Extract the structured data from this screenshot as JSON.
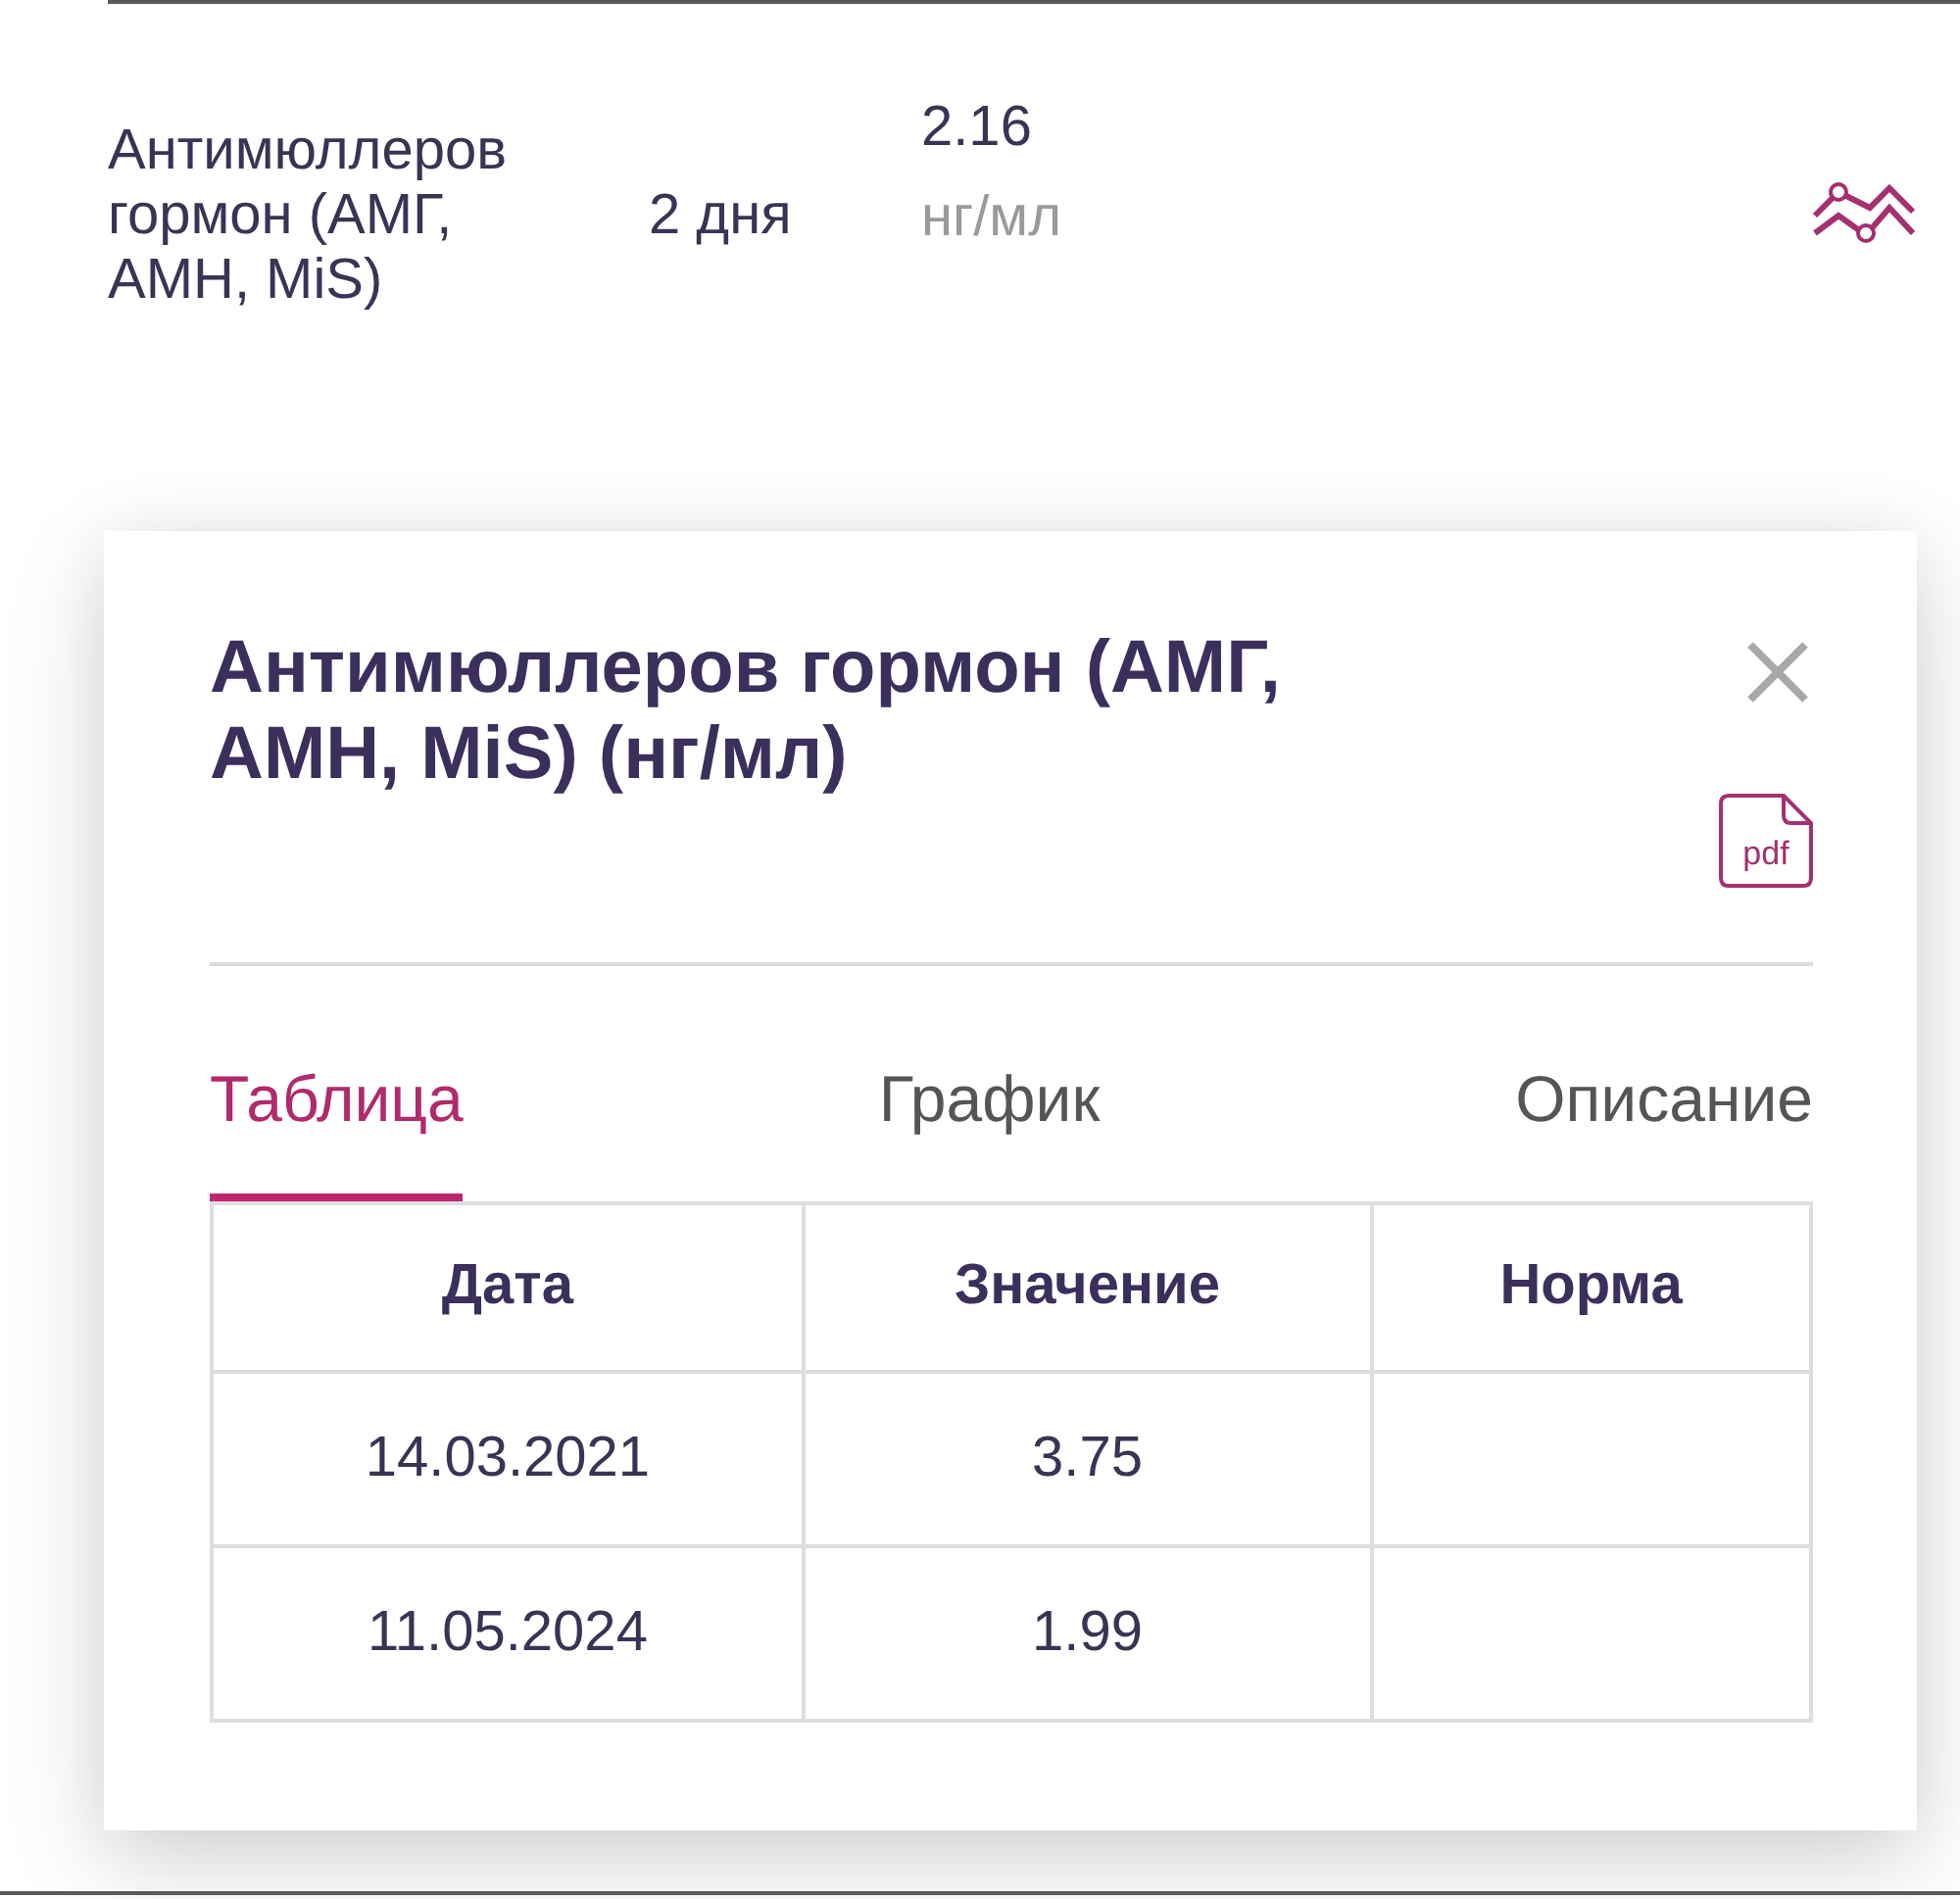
{
  "result_row": {
    "name": "Антимюллеров гормон (АМГ, АМН, MiS)",
    "term": "2 дня",
    "value": "2.16",
    "unit": "нг/мл"
  },
  "modal": {
    "title": "Антимюллеров гормон (АМГ, АМН, MiS) (нг/мл)",
    "pdf_label": "pdf",
    "tabs": [
      {
        "label": "Таблица",
        "selected": true
      },
      {
        "label": "График",
        "selected": false
      },
      {
        "label": "Описание",
        "selected": false
      }
    ],
    "table": {
      "columns": [
        "Дата",
        "Значение",
        "Норма"
      ],
      "rows": [
        {
          "date": "14.03.2021",
          "value": "3.75"
        },
        {
          "date": "11.05.2024",
          "value": "1.99"
        }
      ]
    }
  }
}
